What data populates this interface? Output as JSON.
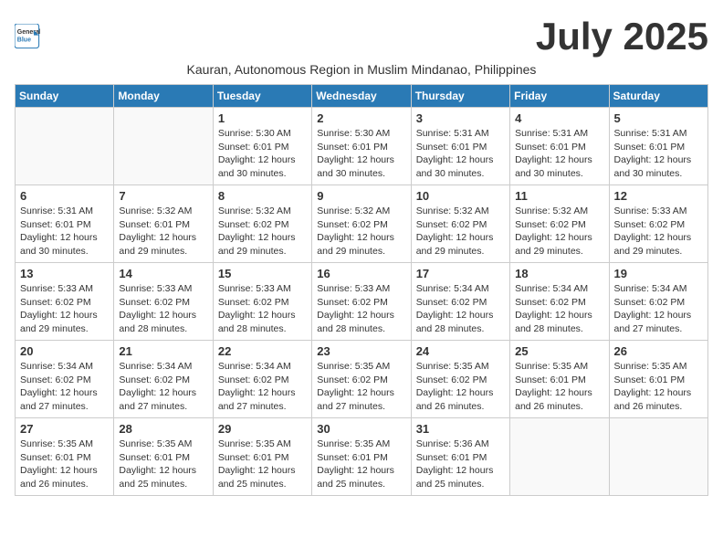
{
  "app": {
    "logo_general": "General",
    "logo_blue": "Blue"
  },
  "title": "July 2025",
  "subtitle": "Kauran, Autonomous Region in Muslim Mindanao, Philippines",
  "weekdays": [
    "Sunday",
    "Monday",
    "Tuesday",
    "Wednesday",
    "Thursday",
    "Friday",
    "Saturday"
  ],
  "weeks": [
    [
      {
        "day": "",
        "sunrise": "",
        "sunset": "",
        "daylight": ""
      },
      {
        "day": "",
        "sunrise": "",
        "sunset": "",
        "daylight": ""
      },
      {
        "day": "1",
        "sunrise": "Sunrise: 5:30 AM",
        "sunset": "Sunset: 6:01 PM",
        "daylight": "Daylight: 12 hours and 30 minutes."
      },
      {
        "day": "2",
        "sunrise": "Sunrise: 5:30 AM",
        "sunset": "Sunset: 6:01 PM",
        "daylight": "Daylight: 12 hours and 30 minutes."
      },
      {
        "day": "3",
        "sunrise": "Sunrise: 5:31 AM",
        "sunset": "Sunset: 6:01 PM",
        "daylight": "Daylight: 12 hours and 30 minutes."
      },
      {
        "day": "4",
        "sunrise": "Sunrise: 5:31 AM",
        "sunset": "Sunset: 6:01 PM",
        "daylight": "Daylight: 12 hours and 30 minutes."
      },
      {
        "day": "5",
        "sunrise": "Sunrise: 5:31 AM",
        "sunset": "Sunset: 6:01 PM",
        "daylight": "Daylight: 12 hours and 30 minutes."
      }
    ],
    [
      {
        "day": "6",
        "sunrise": "Sunrise: 5:31 AM",
        "sunset": "Sunset: 6:01 PM",
        "daylight": "Daylight: 12 hours and 30 minutes."
      },
      {
        "day": "7",
        "sunrise": "Sunrise: 5:32 AM",
        "sunset": "Sunset: 6:01 PM",
        "daylight": "Daylight: 12 hours and 29 minutes."
      },
      {
        "day": "8",
        "sunrise": "Sunrise: 5:32 AM",
        "sunset": "Sunset: 6:02 PM",
        "daylight": "Daylight: 12 hours and 29 minutes."
      },
      {
        "day": "9",
        "sunrise": "Sunrise: 5:32 AM",
        "sunset": "Sunset: 6:02 PM",
        "daylight": "Daylight: 12 hours and 29 minutes."
      },
      {
        "day": "10",
        "sunrise": "Sunrise: 5:32 AM",
        "sunset": "Sunset: 6:02 PM",
        "daylight": "Daylight: 12 hours and 29 minutes."
      },
      {
        "day": "11",
        "sunrise": "Sunrise: 5:32 AM",
        "sunset": "Sunset: 6:02 PM",
        "daylight": "Daylight: 12 hours and 29 minutes."
      },
      {
        "day": "12",
        "sunrise": "Sunrise: 5:33 AM",
        "sunset": "Sunset: 6:02 PM",
        "daylight": "Daylight: 12 hours and 29 minutes."
      }
    ],
    [
      {
        "day": "13",
        "sunrise": "Sunrise: 5:33 AM",
        "sunset": "Sunset: 6:02 PM",
        "daylight": "Daylight: 12 hours and 29 minutes."
      },
      {
        "day": "14",
        "sunrise": "Sunrise: 5:33 AM",
        "sunset": "Sunset: 6:02 PM",
        "daylight": "Daylight: 12 hours and 28 minutes."
      },
      {
        "day": "15",
        "sunrise": "Sunrise: 5:33 AM",
        "sunset": "Sunset: 6:02 PM",
        "daylight": "Daylight: 12 hours and 28 minutes."
      },
      {
        "day": "16",
        "sunrise": "Sunrise: 5:33 AM",
        "sunset": "Sunset: 6:02 PM",
        "daylight": "Daylight: 12 hours and 28 minutes."
      },
      {
        "day": "17",
        "sunrise": "Sunrise: 5:34 AM",
        "sunset": "Sunset: 6:02 PM",
        "daylight": "Daylight: 12 hours and 28 minutes."
      },
      {
        "day": "18",
        "sunrise": "Sunrise: 5:34 AM",
        "sunset": "Sunset: 6:02 PM",
        "daylight": "Daylight: 12 hours and 28 minutes."
      },
      {
        "day": "19",
        "sunrise": "Sunrise: 5:34 AM",
        "sunset": "Sunset: 6:02 PM",
        "daylight": "Daylight: 12 hours and 27 minutes."
      }
    ],
    [
      {
        "day": "20",
        "sunrise": "Sunrise: 5:34 AM",
        "sunset": "Sunset: 6:02 PM",
        "daylight": "Daylight: 12 hours and 27 minutes."
      },
      {
        "day": "21",
        "sunrise": "Sunrise: 5:34 AM",
        "sunset": "Sunset: 6:02 PM",
        "daylight": "Daylight: 12 hours and 27 minutes."
      },
      {
        "day": "22",
        "sunrise": "Sunrise: 5:34 AM",
        "sunset": "Sunset: 6:02 PM",
        "daylight": "Daylight: 12 hours and 27 minutes."
      },
      {
        "day": "23",
        "sunrise": "Sunrise: 5:35 AM",
        "sunset": "Sunset: 6:02 PM",
        "daylight": "Daylight: 12 hours and 27 minutes."
      },
      {
        "day": "24",
        "sunrise": "Sunrise: 5:35 AM",
        "sunset": "Sunset: 6:02 PM",
        "daylight": "Daylight: 12 hours and 26 minutes."
      },
      {
        "day": "25",
        "sunrise": "Sunrise: 5:35 AM",
        "sunset": "Sunset: 6:01 PM",
        "daylight": "Daylight: 12 hours and 26 minutes."
      },
      {
        "day": "26",
        "sunrise": "Sunrise: 5:35 AM",
        "sunset": "Sunset: 6:01 PM",
        "daylight": "Daylight: 12 hours and 26 minutes."
      }
    ],
    [
      {
        "day": "27",
        "sunrise": "Sunrise: 5:35 AM",
        "sunset": "Sunset: 6:01 PM",
        "daylight": "Daylight: 12 hours and 26 minutes."
      },
      {
        "day": "28",
        "sunrise": "Sunrise: 5:35 AM",
        "sunset": "Sunset: 6:01 PM",
        "daylight": "Daylight: 12 hours and 25 minutes."
      },
      {
        "day": "29",
        "sunrise": "Sunrise: 5:35 AM",
        "sunset": "Sunset: 6:01 PM",
        "daylight": "Daylight: 12 hours and 25 minutes."
      },
      {
        "day": "30",
        "sunrise": "Sunrise: 5:35 AM",
        "sunset": "Sunset: 6:01 PM",
        "daylight": "Daylight: 12 hours and 25 minutes."
      },
      {
        "day": "31",
        "sunrise": "Sunrise: 5:36 AM",
        "sunset": "Sunset: 6:01 PM",
        "daylight": "Daylight: 12 hours and 25 minutes."
      },
      {
        "day": "",
        "sunrise": "",
        "sunset": "",
        "daylight": ""
      },
      {
        "day": "",
        "sunrise": "",
        "sunset": "",
        "daylight": ""
      }
    ]
  ]
}
